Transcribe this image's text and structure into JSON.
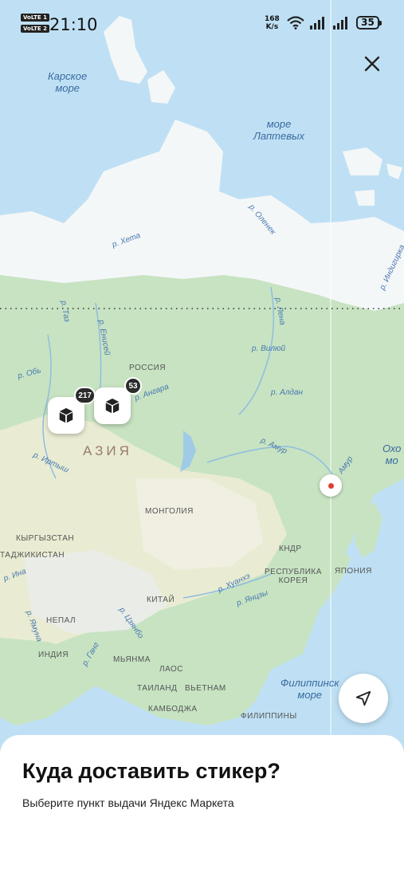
{
  "status_bar": {
    "volte_1": "VoLTE 1",
    "volte_2": "VoLTE 2",
    "time": "21:10",
    "net_speed_value": "168",
    "net_speed_unit": "K/s",
    "battery": "35"
  },
  "map": {
    "labels": {
      "kara_sea": "Карское\nморе",
      "laptev_sea": "море\nЛаптевых",
      "okhotsk_sea": "Охо\nмо",
      "philippine_sea": "Филиппинск\nморе",
      "russia": "РОССИЯ",
      "asia": "АЗИЯ",
      "mongolia": "МОНГОЛИЯ",
      "kyrgyzstan": "КЫРГЫЗСТАН",
      "tajikistan": "ТАДЖИКИСТАН",
      "nepal": "НЕПАЛ",
      "india": "ИНДИЯ",
      "china": "КИТАЙ",
      "myanmar": "МЬЯНМА",
      "laos": "ЛАОС",
      "thailand": "ТАИЛАНД",
      "vietnam": "ВЬЕТНАМ",
      "cambodia": "КАМБОДЖА",
      "philippines": "ФИЛИППИНЫ",
      "north_korea": "КНДР",
      "south_korea": "РЕСПУБЛИКА\nКОРЕЯ",
      "japan": "ЯПОНИЯ",
      "r_kheta": "р. Хета",
      "r_olenek": "р. Оленек",
      "r_indigirka": "р. Индигирка",
      "r_taz": "р. Таз",
      "r_enisey": "р. Енисей",
      "r_lena": "р. Лена",
      "r_vilyuy": "р. Вилюй",
      "r_ob": "р. Обь",
      "r_angara": "р. Ангара",
      "r_aldan": "р. Алдан",
      "r_irtysh": "р. Иртыш",
      "r_amur": "р. Амур",
      "r_amur_2": "Амур",
      "r_ina": "р. Ина",
      "r_huanhe": "р. Хуанхэ",
      "r_yanczy": "р. Янцзы",
      "r_czanpo": "р. Цзянбо",
      "r_ganges": "р. Ганг",
      "r_yamuna": "р. Ямуна"
    },
    "markers": [
      {
        "count": "217",
        "icon": "box-icon"
      },
      {
        "count": "53",
        "icon": "box-icon"
      }
    ]
  },
  "sheet": {
    "title": "Куда доставить стикер?",
    "subtitle": "Выберите пункт выдачи Яндекс Маркета"
  },
  "colors": {
    "water": "#bfe0f4",
    "ice": "#f4f7f8",
    "forest": "#c7e3c2",
    "steppe": "#e9ecd2",
    "desert": "#f1efe2",
    "mountains": "#eaece8",
    "accent_red": "#e03c31"
  }
}
